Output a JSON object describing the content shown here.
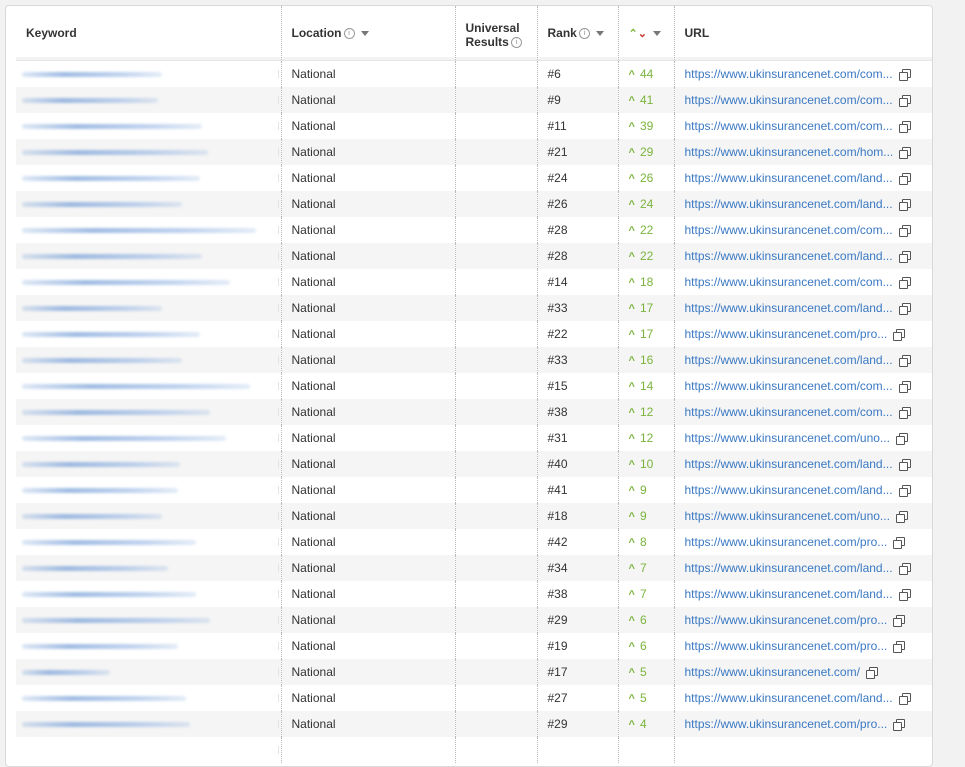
{
  "columns": {
    "keyword": "Keyword",
    "location": "Location",
    "universal_line1": "Universal",
    "universal_line2": "Results",
    "rank": "Rank",
    "change_up": "⌃",
    "change_down": "⌄",
    "url": "URL"
  },
  "up_arrow": "^",
  "rows": [
    {
      "location": "National",
      "rank": "#6",
      "change": "44",
      "url": "https://www.ukinsurancenet.com/com..."
    },
    {
      "location": "National",
      "rank": "#9",
      "change": "41",
      "url": "https://www.ukinsurancenet.com/com..."
    },
    {
      "location": "National",
      "rank": "#11",
      "change": "39",
      "url": "https://www.ukinsurancenet.com/com..."
    },
    {
      "location": "National",
      "rank": "#21",
      "change": "29",
      "url": "https://www.ukinsurancenet.com/hom..."
    },
    {
      "location": "National",
      "rank": "#24",
      "change": "26",
      "url": "https://www.ukinsurancenet.com/land..."
    },
    {
      "location": "National",
      "rank": "#26",
      "change": "24",
      "url": "https://www.ukinsurancenet.com/land..."
    },
    {
      "location": "National",
      "rank": "#28",
      "change": "22",
      "url": "https://www.ukinsurancenet.com/com..."
    },
    {
      "location": "National",
      "rank": "#28",
      "change": "22",
      "url": "https://www.ukinsurancenet.com/land..."
    },
    {
      "location": "National",
      "rank": "#14",
      "change": "18",
      "url": "https://www.ukinsurancenet.com/com..."
    },
    {
      "location": "National",
      "rank": "#33",
      "change": "17",
      "url": "https://www.ukinsurancenet.com/land..."
    },
    {
      "location": "National",
      "rank": "#22",
      "change": "17",
      "url": "https://www.ukinsurancenet.com/pro..."
    },
    {
      "location": "National",
      "rank": "#33",
      "change": "16",
      "url": "https://www.ukinsurancenet.com/land..."
    },
    {
      "location": "National",
      "rank": "#15",
      "change": "14",
      "url": "https://www.ukinsurancenet.com/com..."
    },
    {
      "location": "National",
      "rank": "#38",
      "change": "12",
      "url": "https://www.ukinsurancenet.com/com..."
    },
    {
      "location": "National",
      "rank": "#31",
      "change": "12",
      "url": "https://www.ukinsurancenet.com/uno..."
    },
    {
      "location": "National",
      "rank": "#40",
      "change": "10",
      "url": "https://www.ukinsurancenet.com/land..."
    },
    {
      "location": "National",
      "rank": "#41",
      "change": "9",
      "url": "https://www.ukinsurancenet.com/land..."
    },
    {
      "location": "National",
      "rank": "#18",
      "change": "9",
      "url": "https://www.ukinsurancenet.com/uno..."
    },
    {
      "location": "National",
      "rank": "#42",
      "change": "8",
      "url": "https://www.ukinsurancenet.com/pro..."
    },
    {
      "location": "National",
      "rank": "#34",
      "change": "7",
      "url": "https://www.ukinsurancenet.com/land..."
    },
    {
      "location": "National",
      "rank": "#38",
      "change": "7",
      "url": "https://www.ukinsurancenet.com/land..."
    },
    {
      "location": "National",
      "rank": "#29",
      "change": "6",
      "url": "https://www.ukinsurancenet.com/pro..."
    },
    {
      "location": "National",
      "rank": "#19",
      "change": "6",
      "url": "https://www.ukinsurancenet.com/pro..."
    },
    {
      "location": "National",
      "rank": "#17",
      "change": "5",
      "url": "https://www.ukinsurancenet.com/"
    },
    {
      "location": "National",
      "rank": "#27",
      "change": "5",
      "url": "https://www.ukinsurancenet.com/land..."
    },
    {
      "location": "National",
      "rank": "#29",
      "change": "4",
      "url": "https://www.ukinsurancenet.com/pro..."
    },
    {
      "location": "",
      "rank": "",
      "change": "",
      "url": ""
    }
  ],
  "colors": {
    "change_positive": "#7ab43c",
    "change_negative": "#c0392b",
    "url_link": "#3a78c3",
    "keyword_blur": "#78a0d7"
  }
}
